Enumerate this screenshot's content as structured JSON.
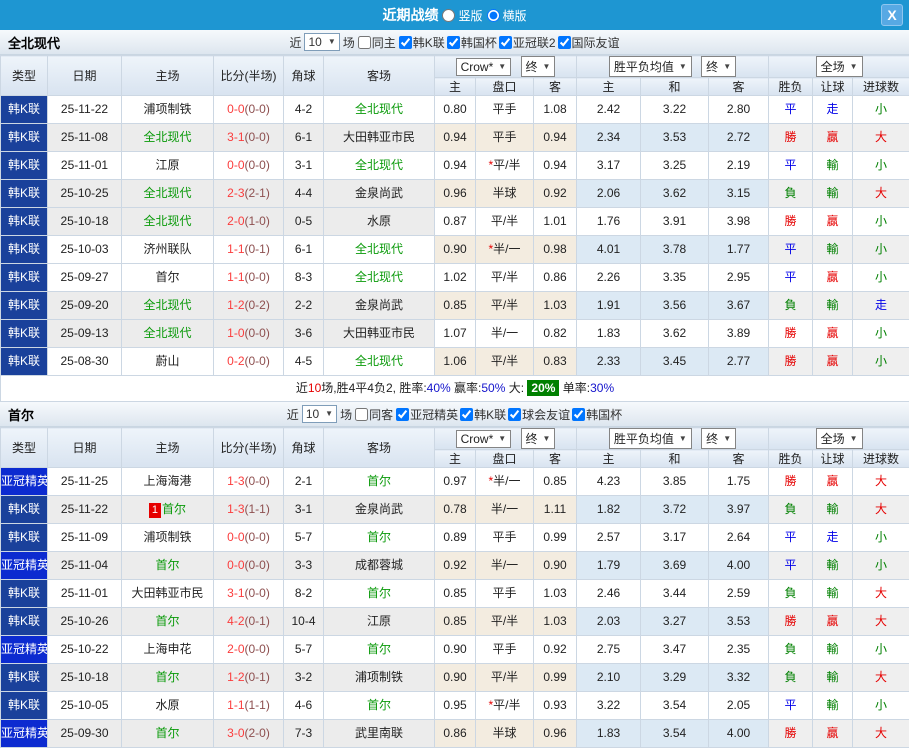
{
  "topbar": {
    "title": "近期战绩",
    "layout_options": [
      {
        "label": "竖版",
        "checked": false
      },
      {
        "label": "横版",
        "checked": true
      }
    ],
    "close": "X"
  },
  "table_headers": {
    "type": "类型",
    "date": "日期",
    "home": "主场",
    "score": "比分(半场)",
    "corner": "角球",
    "away": "客场",
    "crow_select": "Crow*",
    "final_select": "终",
    "avg_select": "胜平负均值",
    "final_select2": "终",
    "scope_select": "全场",
    "crow_home": "主",
    "crow_hcp": "盘口",
    "crow_away": "客",
    "avg_home": "主",
    "avg_draw": "和",
    "avg_away": "客",
    "result": "胜负",
    "handicap": "让球",
    "goals": "进球数"
  },
  "sections": [
    {
      "team": "全北现代",
      "filters": {
        "near": "近",
        "count": "10",
        "games": "场",
        "same": {
          "label": "同主",
          "checked": false
        },
        "leagues": [
          {
            "label": "韩K联",
            "checked": true
          },
          {
            "label": "韩国杯",
            "checked": true
          },
          {
            "label": "亚冠联2",
            "checked": true
          },
          {
            "label": "国际友谊",
            "checked": true
          }
        ]
      },
      "rows": [
        {
          "league": "韩K联",
          "league_type": "kleague",
          "date": "25-11-22",
          "home": "浦项制铁",
          "home_subject": false,
          "rank": "",
          "score": "0-0",
          "half": "(0-0)",
          "corner": "4-2",
          "away": "全北现代",
          "away_subject": true,
          "home_game": false,
          "crow_home": "0.80",
          "hcp": "平手",
          "hcp_star": false,
          "crow_away": "1.08",
          "avg_home": "2.42",
          "avg_draw": "3.22",
          "avg_away": "2.80",
          "res": {
            "t": "平",
            "c": "blue"
          },
          "hres": {
            "t": "走",
            "c": "blue"
          },
          "gres": {
            "t": "小",
            "c": "green"
          }
        },
        {
          "league": "韩K联",
          "league_type": "kleague",
          "date": "25-11-08",
          "home": "全北现代",
          "home_subject": true,
          "rank": "",
          "score": "3-1",
          "half": "(0-0)",
          "corner": "6-1",
          "away": "大田韩亚市民",
          "away_subject": false,
          "home_game": true,
          "crow_home": "0.94",
          "hcp": "平手",
          "hcp_star": false,
          "crow_away": "0.94",
          "avg_home": "2.34",
          "avg_draw": "3.53",
          "avg_away": "2.72",
          "res": {
            "t": "勝",
            "c": "red"
          },
          "hres": {
            "t": "贏",
            "c": "red"
          },
          "gres": {
            "t": "大",
            "c": "red"
          }
        },
        {
          "league": "韩K联",
          "league_type": "kleague",
          "date": "25-11-01",
          "home": "江原",
          "home_subject": false,
          "rank": "",
          "score": "0-0",
          "half": "(0-0)",
          "corner": "3-1",
          "away": "全北现代",
          "away_subject": true,
          "home_game": false,
          "crow_home": "0.94",
          "hcp": "平/半",
          "hcp_star": true,
          "crow_away": "0.94",
          "avg_home": "3.17",
          "avg_draw": "3.25",
          "avg_away": "2.19",
          "res": {
            "t": "平",
            "c": "blue"
          },
          "hres": {
            "t": "輸",
            "c": "green"
          },
          "gres": {
            "t": "小",
            "c": "green"
          }
        },
        {
          "league": "韩K联",
          "league_type": "kleague",
          "date": "25-10-25",
          "home": "全北现代",
          "home_subject": true,
          "rank": "",
          "score": "2-3",
          "half": "(2-1)",
          "corner": "4-4",
          "away": "金泉尚武",
          "away_subject": false,
          "home_game": true,
          "crow_home": "0.96",
          "hcp": "半球",
          "hcp_star": false,
          "crow_away": "0.92",
          "avg_home": "2.06",
          "avg_draw": "3.62",
          "avg_away": "3.15",
          "res": {
            "t": "負",
            "c": "green"
          },
          "hres": {
            "t": "輸",
            "c": "green"
          },
          "gres": {
            "t": "大",
            "c": "red"
          }
        },
        {
          "league": "韩K联",
          "league_type": "kleague",
          "date": "25-10-18",
          "home": "全北现代",
          "home_subject": true,
          "rank": "",
          "score": "2-0",
          "half": "(1-0)",
          "corner": "0-5",
          "away": "水原",
          "away_subject": false,
          "home_game": true,
          "crow_home": "0.87",
          "hcp": "平/半",
          "hcp_star": false,
          "crow_away": "1.01",
          "avg_home": "1.76",
          "avg_draw": "3.91",
          "avg_away": "3.98",
          "res": {
            "t": "勝",
            "c": "red"
          },
          "hres": {
            "t": "贏",
            "c": "red"
          },
          "gres": {
            "t": "小",
            "c": "green"
          }
        },
        {
          "league": "韩K联",
          "league_type": "kleague",
          "date": "25-10-03",
          "home": "济州联队",
          "home_subject": false,
          "rank": "",
          "score": "1-1",
          "half": "(0-1)",
          "corner": "6-1",
          "away": "全北现代",
          "away_subject": true,
          "home_game": false,
          "crow_home": "0.90",
          "hcp": "半/一",
          "hcp_star": true,
          "crow_away": "0.98",
          "avg_home": "4.01",
          "avg_draw": "3.78",
          "avg_away": "1.77",
          "res": {
            "t": "平",
            "c": "blue"
          },
          "hres": {
            "t": "輸",
            "c": "green"
          },
          "gres": {
            "t": "小",
            "c": "green"
          }
        },
        {
          "league": "韩K联",
          "league_type": "kleague",
          "date": "25-09-27",
          "home": "首尔",
          "home_subject": false,
          "rank": "",
          "score": "1-1",
          "half": "(0-0)",
          "corner": "8-3",
          "away": "全北现代",
          "away_subject": true,
          "home_game": false,
          "crow_home": "1.02",
          "hcp": "平/半",
          "hcp_star": false,
          "crow_away": "0.86",
          "avg_home": "2.26",
          "avg_draw": "3.35",
          "avg_away": "2.95",
          "res": {
            "t": "平",
            "c": "blue"
          },
          "hres": {
            "t": "贏",
            "c": "red"
          },
          "gres": {
            "t": "小",
            "c": "green"
          }
        },
        {
          "league": "韩K联",
          "league_type": "kleague",
          "date": "25-09-20",
          "home": "全北现代",
          "home_subject": true,
          "rank": "",
          "score": "1-2",
          "half": "(0-2)",
          "corner": "2-2",
          "away": "金泉尚武",
          "away_subject": false,
          "home_game": true,
          "crow_home": "0.85",
          "hcp": "平/半",
          "hcp_star": false,
          "crow_away": "1.03",
          "avg_home": "1.91",
          "avg_draw": "3.56",
          "avg_away": "3.67",
          "res": {
            "t": "負",
            "c": "green"
          },
          "hres": {
            "t": "輸",
            "c": "green"
          },
          "gres": {
            "t": "走",
            "c": "blue"
          }
        },
        {
          "league": "韩K联",
          "league_type": "kleague",
          "date": "25-09-13",
          "home": "全北现代",
          "home_subject": true,
          "rank": "",
          "score": "1-0",
          "half": "(0-0)",
          "corner": "3-6",
          "away": "大田韩亚市民",
          "away_subject": false,
          "home_game": true,
          "crow_home": "1.07",
          "hcp": "半/一",
          "hcp_star": false,
          "crow_away": "0.82",
          "avg_home": "1.83",
          "avg_draw": "3.62",
          "avg_away": "3.89",
          "res": {
            "t": "勝",
            "c": "red"
          },
          "hres": {
            "t": "贏",
            "c": "red"
          },
          "gres": {
            "t": "小",
            "c": "green"
          }
        },
        {
          "league": "韩K联",
          "league_type": "kleague",
          "date": "25-08-30",
          "home": "蔚山",
          "home_subject": false,
          "rank": "",
          "score": "0-2",
          "half": "(0-0)",
          "corner": "4-5",
          "away": "全北现代",
          "away_subject": true,
          "home_game": false,
          "crow_home": "1.06",
          "hcp": "平/半",
          "hcp_star": false,
          "crow_away": "0.83",
          "avg_home": "2.33",
          "avg_draw": "3.45",
          "avg_away": "2.77",
          "res": {
            "t": "勝",
            "c": "red"
          },
          "hres": {
            "t": "贏",
            "c": "red"
          },
          "gres": {
            "t": "小",
            "c": "green"
          }
        }
      ],
      "summary": [
        {
          "t": "近"
        },
        {
          "t": "10",
          "c": "red"
        },
        {
          "t": "场,胜4平4负2, "
        },
        {
          "t": "胜率:"
        },
        {
          "t": "40%",
          "c": "blue"
        },
        {
          "t": " 赢率:"
        },
        {
          "t": "50%",
          "c": "blue"
        },
        {
          "t": " 大: "
        },
        {
          "t": "20%",
          "c": "badge"
        },
        {
          "t": " 单率:"
        },
        {
          "t": "30%",
          "c": "blue"
        }
      ]
    },
    {
      "team": "首尔",
      "filters": {
        "near": "近",
        "count": "10",
        "games": "场",
        "same": {
          "label": "同客",
          "checked": false
        },
        "leagues": [
          {
            "label": "亚冠精英",
            "checked": true
          },
          {
            "label": "韩K联",
            "checked": true
          },
          {
            "label": "球会友谊",
            "checked": true
          },
          {
            "label": "韩国杯",
            "checked": true
          }
        ]
      },
      "rows": [
        {
          "league": "亚冠精英",
          "league_type": "acl",
          "date": "25-11-25",
          "home": "上海海港",
          "home_subject": false,
          "rank": "",
          "score": "1-3",
          "half": "(0-0)",
          "corner": "2-1",
          "away": "首尔",
          "away_subject": true,
          "home_game": false,
          "crow_home": "0.97",
          "hcp": "半/一",
          "hcp_star": true,
          "crow_away": "0.85",
          "avg_home": "4.23",
          "avg_draw": "3.85",
          "avg_away": "1.75",
          "res": {
            "t": "勝",
            "c": "red"
          },
          "hres": {
            "t": "贏",
            "c": "red"
          },
          "gres": {
            "t": "大",
            "c": "red"
          }
        },
        {
          "league": "韩K联",
          "league_type": "kleague",
          "date": "25-11-22",
          "home": "首尔",
          "home_subject": true,
          "rank": "1",
          "score": "1-3",
          "half": "(1-1)",
          "corner": "3-1",
          "away": "金泉尚武",
          "away_subject": false,
          "home_game": true,
          "crow_home": "0.78",
          "hcp": "半/一",
          "hcp_star": false,
          "crow_away": "1.11",
          "avg_home": "1.82",
          "avg_draw": "3.72",
          "avg_away": "3.97",
          "res": {
            "t": "負",
            "c": "green"
          },
          "hres": {
            "t": "輸",
            "c": "green"
          },
          "gres": {
            "t": "大",
            "c": "red"
          }
        },
        {
          "league": "韩K联",
          "league_type": "kleague",
          "date": "25-11-09",
          "home": "浦项制铁",
          "home_subject": false,
          "rank": "",
          "score": "0-0",
          "half": "(0-0)",
          "corner": "5-7",
          "away": "首尔",
          "away_subject": true,
          "home_game": false,
          "crow_home": "0.89",
          "hcp": "平手",
          "hcp_star": false,
          "crow_away": "0.99",
          "avg_home": "2.57",
          "avg_draw": "3.17",
          "avg_away": "2.64",
          "res": {
            "t": "平",
            "c": "blue"
          },
          "hres": {
            "t": "走",
            "c": "blue"
          },
          "gres": {
            "t": "小",
            "c": "green"
          }
        },
        {
          "league": "亚冠精英",
          "league_type": "acl",
          "date": "25-11-04",
          "home": "首尔",
          "home_subject": true,
          "rank": "",
          "score": "0-0",
          "half": "(0-0)",
          "corner": "3-3",
          "away": "成都蓉城",
          "away_subject": false,
          "home_game": true,
          "crow_home": "0.92",
          "hcp": "半/一",
          "hcp_star": false,
          "crow_away": "0.90",
          "avg_home": "1.79",
          "avg_draw": "3.69",
          "avg_away": "4.00",
          "res": {
            "t": "平",
            "c": "blue"
          },
          "hres": {
            "t": "輸",
            "c": "green"
          },
          "gres": {
            "t": "小",
            "c": "green"
          }
        },
        {
          "league": "韩K联",
          "league_type": "kleague",
          "date": "25-11-01",
          "home": "大田韩亚市民",
          "home_subject": false,
          "rank": "",
          "score": "3-1",
          "half": "(0-0)",
          "corner": "8-2",
          "away": "首尔",
          "away_subject": true,
          "home_game": false,
          "crow_home": "0.85",
          "hcp": "平手",
          "hcp_star": false,
          "crow_away": "1.03",
          "avg_home": "2.46",
          "avg_draw": "3.44",
          "avg_away": "2.59",
          "res": {
            "t": "負",
            "c": "green"
          },
          "hres": {
            "t": "輸",
            "c": "green"
          },
          "gres": {
            "t": "大",
            "c": "red"
          }
        },
        {
          "league": "韩K联",
          "league_type": "kleague",
          "date": "25-10-26",
          "home": "首尔",
          "home_subject": true,
          "rank": "",
          "score": "4-2",
          "half": "(0-1)",
          "corner": "10-4",
          "away": "江原",
          "away_subject": false,
          "home_game": true,
          "crow_home": "0.85",
          "hcp": "平/半",
          "hcp_star": false,
          "crow_away": "1.03",
          "avg_home": "2.03",
          "avg_draw": "3.27",
          "avg_away": "3.53",
          "res": {
            "t": "勝",
            "c": "red"
          },
          "hres": {
            "t": "贏",
            "c": "red"
          },
          "gres": {
            "t": "大",
            "c": "red"
          }
        },
        {
          "league": "亚冠精英",
          "league_type": "acl",
          "date": "25-10-22",
          "home": "上海申花",
          "home_subject": false,
          "rank": "",
          "score": "2-0",
          "half": "(0-0)",
          "corner": "5-7",
          "away": "首尔",
          "away_subject": true,
          "home_game": false,
          "crow_home": "0.90",
          "hcp": "平手",
          "hcp_star": false,
          "crow_away": "0.92",
          "avg_home": "2.75",
          "avg_draw": "3.47",
          "avg_away": "2.35",
          "res": {
            "t": "負",
            "c": "green"
          },
          "hres": {
            "t": "輸",
            "c": "green"
          },
          "gres": {
            "t": "小",
            "c": "green"
          }
        },
        {
          "league": "韩K联",
          "league_type": "kleague",
          "date": "25-10-18",
          "home": "首尔",
          "home_subject": true,
          "rank": "",
          "score": "1-2",
          "half": "(0-1)",
          "corner": "3-2",
          "away": "浦项制铁",
          "away_subject": false,
          "home_game": true,
          "crow_home": "0.90",
          "hcp": "平/半",
          "hcp_star": false,
          "crow_away": "0.99",
          "avg_home": "2.10",
          "avg_draw": "3.29",
          "avg_away": "3.32",
          "res": {
            "t": "負",
            "c": "green"
          },
          "hres": {
            "t": "輸",
            "c": "green"
          },
          "gres": {
            "t": "大",
            "c": "red"
          }
        },
        {
          "league": "韩K联",
          "league_type": "kleague",
          "date": "25-10-05",
          "home": "水原",
          "home_subject": false,
          "rank": "",
          "score": "1-1",
          "half": "(1-1)",
          "corner": "4-6",
          "away": "首尔",
          "away_subject": true,
          "home_game": false,
          "crow_home": "0.95",
          "hcp": "平/半",
          "hcp_star": true,
          "crow_away": "0.93",
          "avg_home": "3.22",
          "avg_draw": "3.54",
          "avg_away": "2.05",
          "res": {
            "t": "平",
            "c": "blue"
          },
          "hres": {
            "t": "輸",
            "c": "green"
          },
          "gres": {
            "t": "小",
            "c": "green"
          }
        },
        {
          "league": "亚冠精英",
          "league_type": "acl",
          "date": "25-09-30",
          "home": "首尔",
          "home_subject": true,
          "rank": "",
          "score": "3-0",
          "half": "(2-0)",
          "corner": "7-3",
          "away": "武里南联",
          "away_subject": false,
          "home_game": true,
          "crow_home": "0.86",
          "hcp": "半球",
          "hcp_star": false,
          "crow_away": "0.96",
          "avg_home": "1.83",
          "avg_draw": "3.54",
          "avg_away": "4.00",
          "res": {
            "t": "勝",
            "c": "red"
          },
          "hres": {
            "t": "贏",
            "c": "red"
          },
          "gres": {
            "t": "大",
            "c": "red"
          }
        }
      ]
    }
  ]
}
